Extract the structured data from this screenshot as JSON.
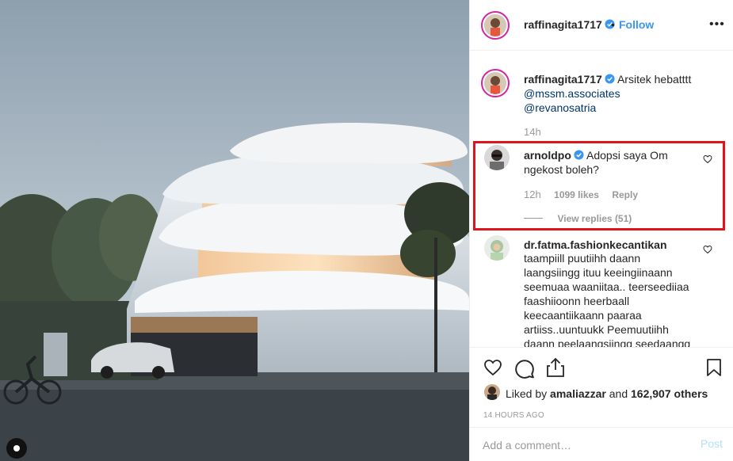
{
  "post": {
    "username": "raffinagita1717",
    "separator": "•",
    "follow_label": "Follow",
    "more_label": "•••"
  },
  "caption": {
    "username": "raffinagita1717",
    "text": "Arsitek hebatttt",
    "mention_1": "@mssm.associates",
    "mention_2": "@revanosatria",
    "age": "14h"
  },
  "comments": [
    {
      "username": "arnoldpo",
      "verified": true,
      "line_1": "Adopsi saya Om",
      "line_2": "ngekost boleh?",
      "age": "12h",
      "likes": "1099 likes",
      "reply_label": "Reply",
      "view_replies": "View replies (51)"
    },
    {
      "username": "dr.fatma.fashionkecantikan",
      "lines": [
        "taampiill puutiihh daann",
        "laangsiingg ituu keeingiinaann",
        "seemuaa waaniitaa.. teerseediiaa",
        "faashiioonn heerbaall",
        "keecaantiikaann paaraa",
        "artiiss..uuntuukk Peemuutiihh",
        "daann peelaangsiingg seedaangg"
      ]
    }
  ],
  "icons": {
    "like": "heart-icon",
    "comment": "comment-icon",
    "share": "share-icon",
    "save": "bookmark-icon",
    "verified": "verified-badge-icon"
  },
  "likes": {
    "prefix": "Liked by ",
    "user": "amaliazzar",
    "middle": " and ",
    "count": "162,907 others"
  },
  "timestamp": "14 HOURS AGO",
  "add_comment": {
    "placeholder": "Add a comment…",
    "post_label": "Post"
  },
  "colors": {
    "link_blue": "#3897f0",
    "verified_blue": "#3897f0",
    "highlight_red": "#e0141b",
    "story_ring": "#d6249f"
  }
}
